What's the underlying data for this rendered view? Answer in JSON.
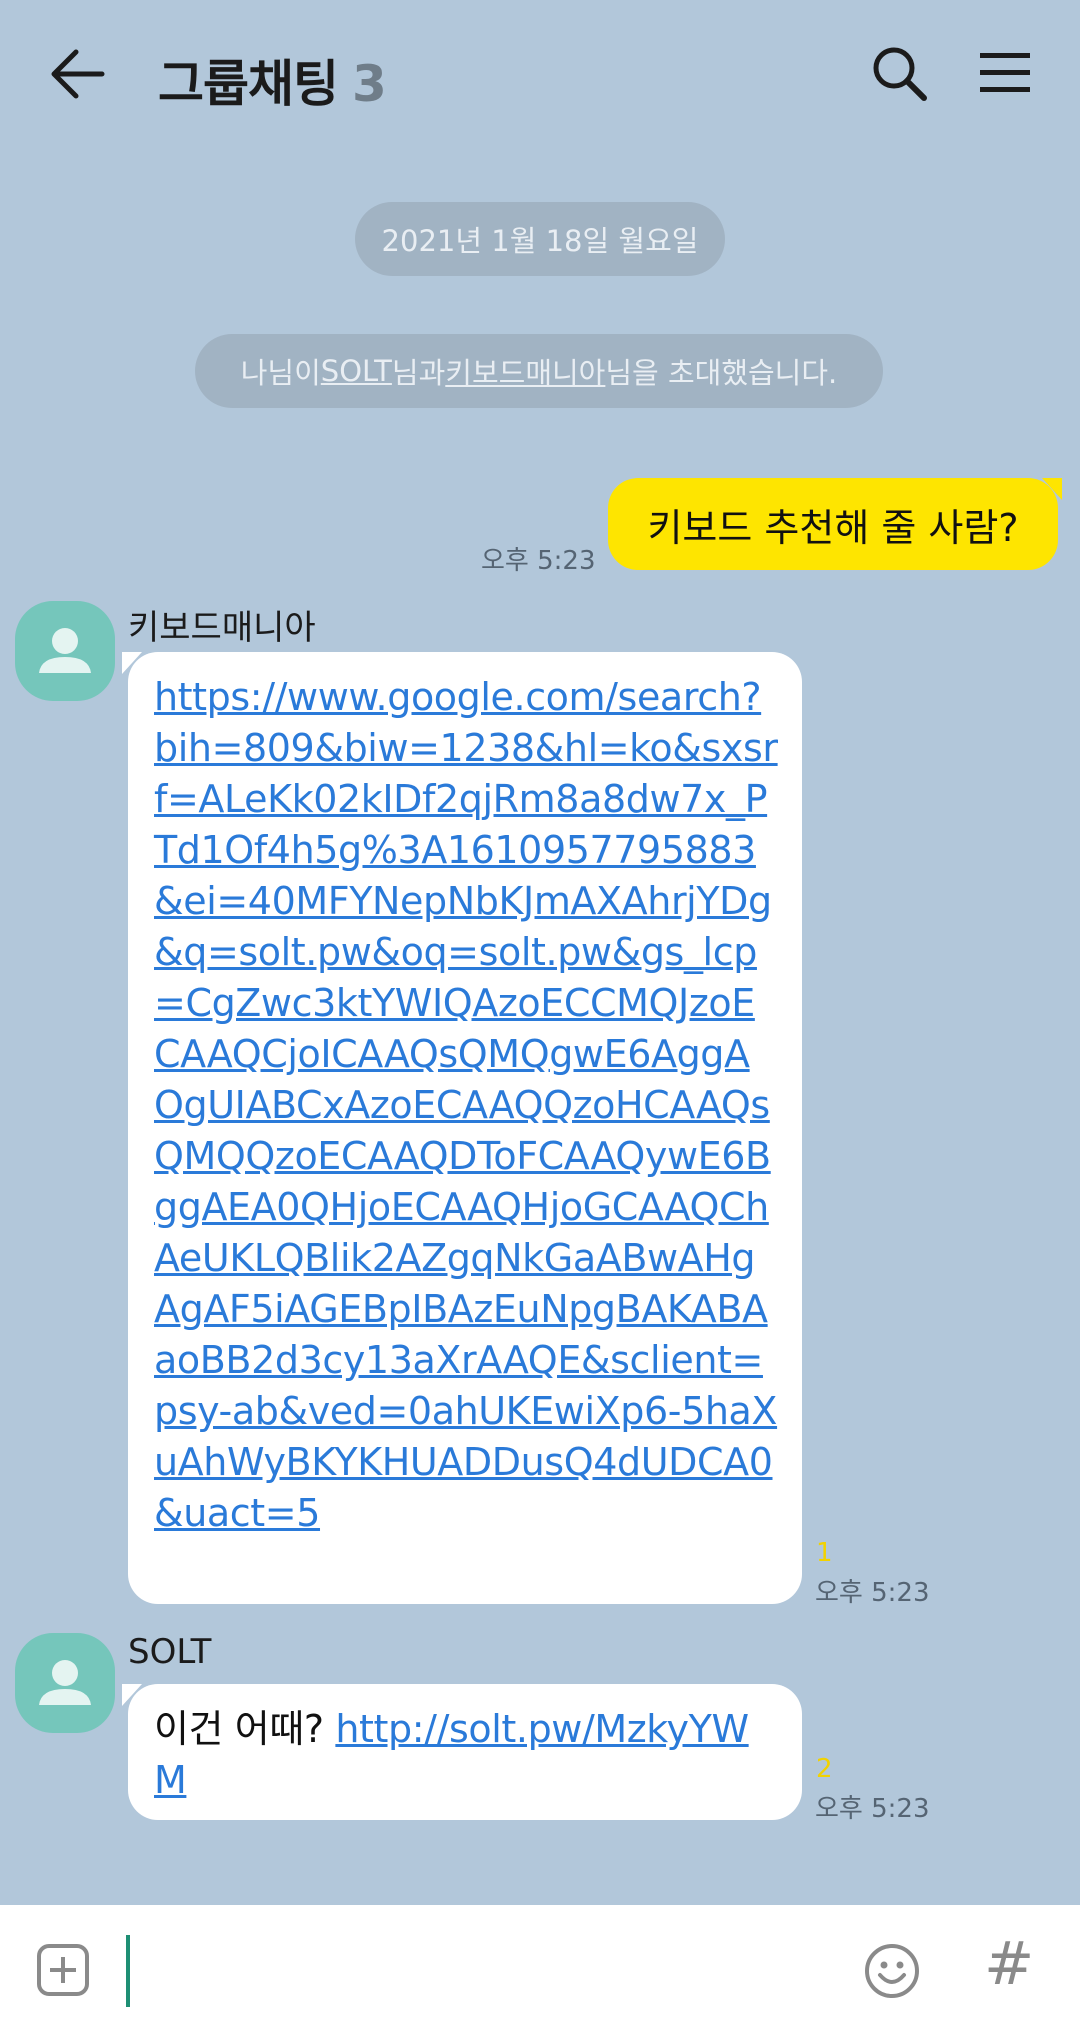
{
  "header": {
    "title": "그룹채팅",
    "member_count": "3"
  },
  "chat": {
    "date_divider": "2021년 1월 18일 월요일",
    "invite_notice": {
      "before": "나님이 ",
      "user1": "SOLT",
      "middle": "님과 ",
      "user2": "키보드매니아",
      "after": "님을 초대했습니다."
    },
    "messages": [
      {
        "sender": "me",
        "text": "키보드 추천해 줄 사람?",
        "time": "오후 5:23"
      },
      {
        "sender": "키보드매니아",
        "link": "https://www.google.com/search?bih=809&biw=1238&hl=ko&sxsrf=ALeKk02kIDf2qjRm8a8dw7x_PTd1Of4h5g%3A1610957795883&ei=40MFYNepNbKJmAXAhrjYDg&q=solt.pw&oq=solt.pw&gs_lcp=CgZwc3ktYWIQAzoECCMQJzoECAAQCjoICAAQsQMQgwE6AggAOgUIABCxAzoECAAQQzoHCAAQsQMQQzoECAAQDToFCAAQywE6BggAEA0QHjoECAAQHjoGCAAQChAeUKLQBlik2AZgqNkGaABwAHgAgAF5iAGEBpIBAzEuNpgBAKABAaoBB2d3cy13aXrAAQE&sclient=psy-ab&ved=0ahUKEwiXp6-5haXuAhWyBKYKHUADDusQ4dUDCA0&uact=5",
        "unread": "1",
        "time": "오후 5:23"
      },
      {
        "sender": "SOLT",
        "text": "이건 어때? ",
        "link": "http://solt.pw/MzkyYWM",
        "unread": "2",
        "time": "오후 5:23"
      }
    ]
  },
  "input": {
    "hash_symbol": "#"
  }
}
